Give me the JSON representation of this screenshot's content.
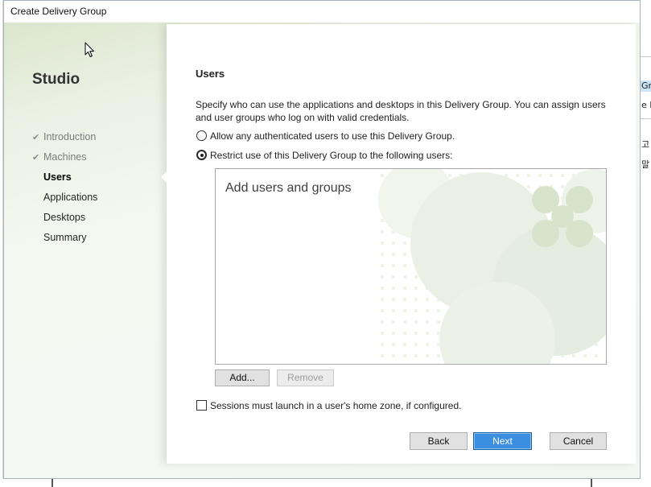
{
  "window": {
    "title": "Create Delivery Group"
  },
  "sidebar": {
    "brand": "Studio",
    "done_icon": "check-icon",
    "items": [
      {
        "label": "Introduction",
        "done": true,
        "current": false
      },
      {
        "label": "Machines",
        "done": true,
        "current": false
      },
      {
        "label": "Users",
        "done": false,
        "current": true
      },
      {
        "label": "Applications",
        "done": false,
        "current": false
      },
      {
        "label": "Desktops",
        "done": false,
        "current": false
      },
      {
        "label": "Summary",
        "done": false,
        "current": false
      }
    ]
  },
  "main": {
    "heading": "Users",
    "description": "Specify who can use the applications and desktops in this Delivery Group. You can assign users and user groups who log on with valid credentials.",
    "access_options": [
      {
        "label": "Allow any authenticated users to use this Delivery Group.",
        "selected": false
      },
      {
        "label": "Restrict use of this Delivery Group to the following users:",
        "selected": true
      }
    ],
    "user_list": {
      "placeholder": "Add users and groups",
      "entries": []
    },
    "add_label": "Add...",
    "remove_label": "Remove",
    "remove_enabled": false,
    "home_zone": {
      "label": "Sessions must launch in a user's home zone, if configured.",
      "checked": false
    }
  },
  "footer": {
    "back_label": "Back",
    "next_label": "Next",
    "cancel_label": "Cancel"
  },
  "background_window": {
    "fragments": [
      "Gro",
      "e D",
      "고",
      "말"
    ]
  },
  "colors": {
    "primary_button": "#3b8ee0",
    "watermark": "#dbe6cf",
    "sidebar_tint": "#e3ecd8"
  }
}
